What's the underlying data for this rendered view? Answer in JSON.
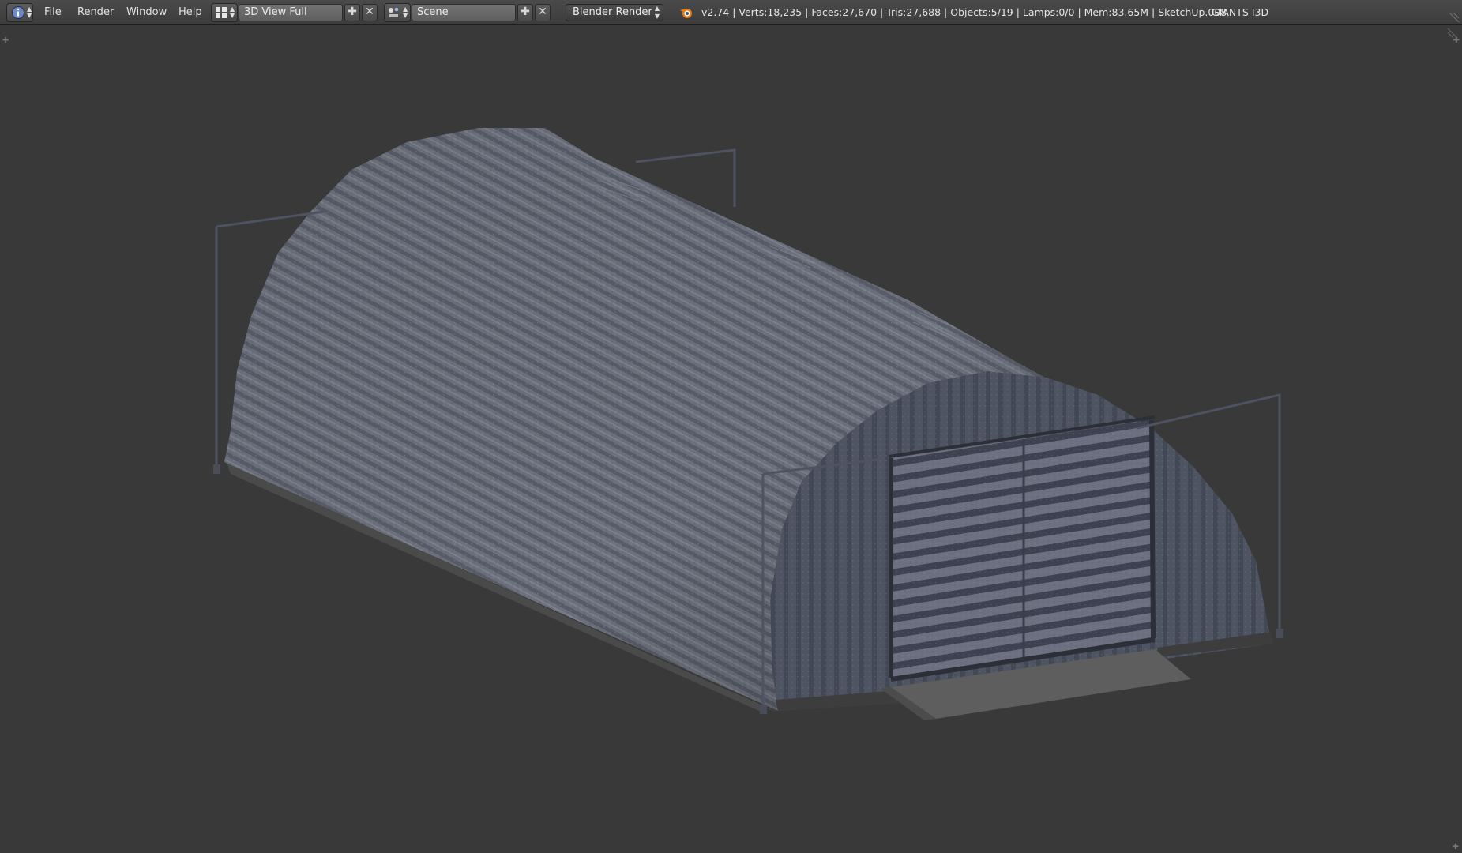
{
  "header": {
    "info_icon": "info-icon",
    "menus": [
      "File",
      "Render",
      "Window",
      "Help"
    ],
    "screen_layout": "3D View Full",
    "scene": "Scene",
    "render_engine": "Blender Render",
    "blender_logo": "blender-logo-icon",
    "stats": "v2.74 | Verts:18,235 | Faces:27,670 | Tris:27,688 | Objects:5/19 | Lamps:0/0 | Mem:83.65M | SketchUp.008",
    "exporter": "GIANTS I3D"
  },
  "viewport": {
    "object": "Quonset hut shed model"
  },
  "colors": {
    "background": "#393939",
    "header": "#444444",
    "roof": "#6b6f7c",
    "door": "#4b505e"
  }
}
